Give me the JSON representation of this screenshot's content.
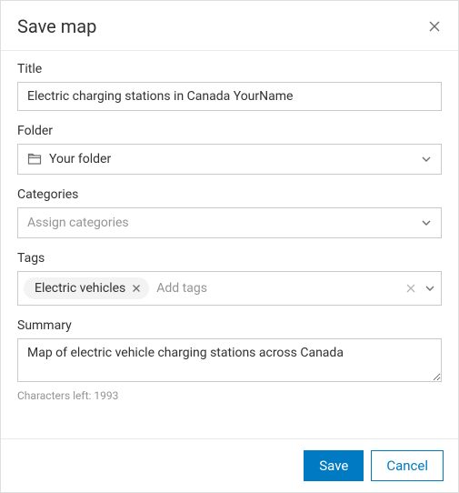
{
  "dialog": {
    "title": "Save map"
  },
  "fields": {
    "title": {
      "label": "Title",
      "value": "Electric charging stations in Canada YourName"
    },
    "folder": {
      "label": "Folder",
      "value": "Your folder"
    },
    "categories": {
      "label": "Categories",
      "placeholder": "Assign categories"
    },
    "tags": {
      "label": "Tags",
      "chips": [
        "Electric vehicles"
      ],
      "placeholder": "Add tags"
    },
    "summary": {
      "label": "Summary",
      "value": "Map of electric vehicle charging stations across Canada",
      "chars_left_label": "Characters left: 1993"
    }
  },
  "buttons": {
    "save": "Save",
    "cancel": "Cancel"
  }
}
